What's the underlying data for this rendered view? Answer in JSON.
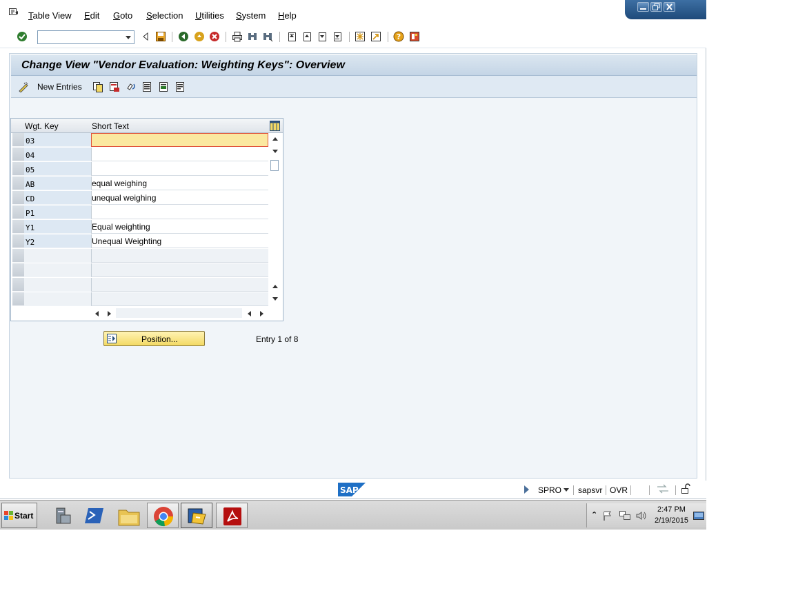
{
  "menu": {
    "items": [
      {
        "underline": "T",
        "rest": "able View"
      },
      {
        "underline": "E",
        "rest": "dit"
      },
      {
        "underline": "G",
        "rest": "oto"
      },
      {
        "underline": "S",
        "rest": "election"
      },
      {
        "underline": "U",
        "rest": "tilities"
      },
      {
        "underline": "S",
        "rest": "ystem"
      },
      {
        "underline": "H",
        "rest": "elp"
      }
    ]
  },
  "toolbar": {
    "command_field_value": "",
    "icons": [
      "enter-icon",
      "back-icon",
      "save-icon",
      "green-back-icon",
      "exit-icon",
      "cancel-icon",
      "print-icon",
      "find-icon",
      "find-next-icon",
      "first-page-icon",
      "previous-page-icon",
      "next-page-icon",
      "last-page-icon",
      "create-session-icon",
      "shortcut-icon",
      "help-icon",
      "customize-layout-icon"
    ]
  },
  "screen": {
    "title": "Change View \"Vendor Evaluation: Weighting Keys\": Overview",
    "app_toolbar": {
      "new_entries_label": "New Entries"
    }
  },
  "table": {
    "columns": [
      "Wgt. Key",
      "Short Text"
    ],
    "rows": [
      {
        "key": "03",
        "text": ""
      },
      {
        "key": "04",
        "text": ""
      },
      {
        "key": "05",
        "text": ""
      },
      {
        "key": "AB",
        "text": "equal weighing"
      },
      {
        "key": "CD",
        "text": "unequal weighing"
      },
      {
        "key": "P1",
        "text": ""
      },
      {
        "key": "Y1",
        "text": "Equal weighting"
      },
      {
        "key": "Y2",
        "text": "Unequal Weighting"
      }
    ],
    "empty_rows": 4
  },
  "position_button_label": "Position...",
  "entry_info": "Entry 1 of 8",
  "status": {
    "transaction": "SPRO",
    "server": "sapsvr",
    "mode": "OVR"
  },
  "taskbar": {
    "start_label": "Start",
    "clock_time": "2:47 PM",
    "clock_date": "2/19/2015"
  },
  "colors": {
    "sap_blue": "#1e6fc5",
    "selected_cell": "#fbe8a0",
    "title_bar": "#c4d5e6"
  }
}
